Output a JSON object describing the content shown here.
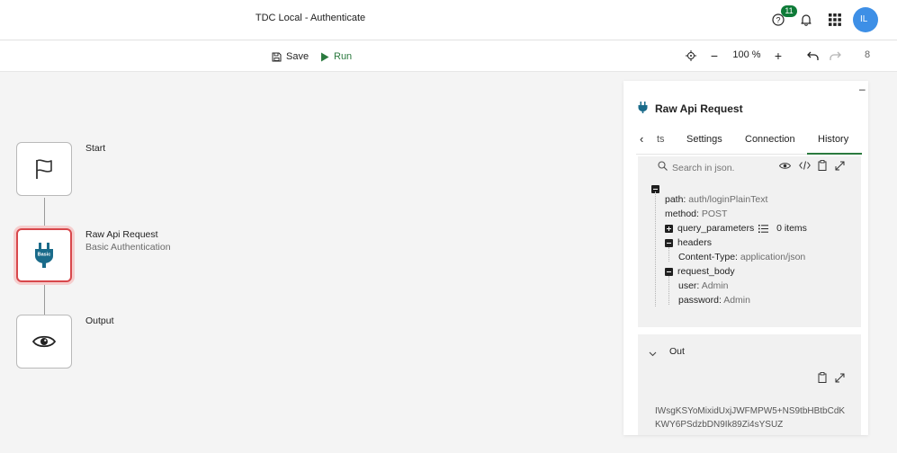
{
  "header": {
    "title": "TDC Local - Authenticate",
    "help_badge_count": "11",
    "avatar_initials": "IL"
  },
  "toolbar": {
    "save_label": "Save",
    "run_label": "Run",
    "zoom_level": "100 %",
    "right_clipped_text": "8"
  },
  "canvas": {
    "nodes": [
      {
        "label": "Start",
        "sublabel": "",
        "icon": "flag-icon"
      },
      {
        "label": "Raw Api Request",
        "sublabel": "Basic Authentication",
        "icon": "basic-plug-icon",
        "icon_text": "Basic"
      },
      {
        "label": "Output",
        "sublabel": "",
        "icon": "eye-icon"
      }
    ]
  },
  "panel": {
    "title": "Raw Api Request",
    "minimize_label": "–",
    "tabs": [
      {
        "label": "ts"
      },
      {
        "label": "Settings"
      },
      {
        "label": "Connection"
      },
      {
        "label": "History"
      }
    ],
    "active_tab": "History",
    "search_placeholder": "Search in json.",
    "json": {
      "path_key": "path:",
      "path_value": "auth/loginPlainText",
      "method_key": "method:",
      "method_value": "POST",
      "query_key": "query_parameters",
      "query_count": "0 items",
      "headers_key": "headers",
      "content_type_key": "Content-Type:",
      "content_type_value": "application/json",
      "request_body_key": "request_body",
      "user_key": "user:",
      "user_value": "Admin",
      "password_key": "password:",
      "password_value": "Admin"
    },
    "out": {
      "label": "Out",
      "text_line1": "IWsgKSYoMixidUxjJWFMPW5+NS9tbHBtbCdK",
      "text_line2": "KWY6PSdzbDN9Ik89Zi4sYSUZ"
    }
  },
  "colors": {
    "accent_green": "#2b7a3f",
    "badge_green": "#0e7b38",
    "selected_red": "#d8474b",
    "avatar_blue": "#3d8fe6",
    "node_icon_teal": "#1a6b8a"
  }
}
